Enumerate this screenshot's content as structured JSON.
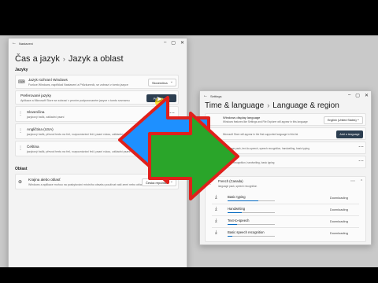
{
  "left_window": {
    "title": "Nastavení",
    "breadcrumb_parent": "Čas a jazyk",
    "breadcrumb_sep": "›",
    "breadcrumb_current": "Jazyk a oblast",
    "section_languages": "Jazyky",
    "display_language": {
      "title": "Jazyk rozhraní Windows",
      "subtitle": "Funkce Windows, například Nastavení a Průzkumník, se zobrazí v tomto jazyce",
      "value": "Slovenčina"
    },
    "preferred": {
      "title": "Preferované jazyky",
      "subtitle": "Aplikace a Microsoft Store se zobrazí v prvním podporovaném jazyce v tomto seznamu",
      "button": "Přidat jazyk"
    },
    "languages": [
      {
        "name": "Slovenčina",
        "detail": "jazykový balík, základní psaní"
      },
      {
        "name": "Angličtina (USA)",
        "detail": "jazykový balík, převod textu na řeč, rozpoznávání řeči, psaní rukou, základní psaní"
      },
      {
        "name": "Čeština",
        "detail": "jazykový balík, převod textu na řeč, rozpoznávání řeči, psaní rukou, základní psaní"
      }
    ],
    "section_region": "Oblast",
    "region": {
      "title": "Krajina alebo oblasť",
      "subtitle": "Windows a aplikace mohou na poskytování místního obsahu používat vaši zemi nebo oblast",
      "value": "Česká republika"
    }
  },
  "right_window": {
    "title": "Settings",
    "breadcrumb_parent": "Time & language",
    "breadcrumb_sep": "›",
    "breadcrumb_current": "Language & region",
    "display_language": {
      "title": "Windows display language",
      "subtitle": "Windows features like Settings and File Explorer will appear in this language",
      "value": "English (United States)"
    },
    "preferred": {
      "subtitle": "Microsoft Store will appear in the first supported language in this list",
      "button": "Add a language"
    },
    "language_row1": {
      "detail": "language pack, text-to-speech, speech recognition, handwriting, basic typing"
    },
    "language_row2": {
      "detail": "speech recognition, handwriting, basic typing"
    },
    "french": {
      "name": "French (Canada)",
      "detail": "language pack, speech recognition"
    },
    "downloads": [
      {
        "name": "Basic typing",
        "status": "Downloading",
        "progress": 0.65
      },
      {
        "name": "Handwriting",
        "status": "Downloading",
        "progress": 0.3
      },
      {
        "name": "Text-to-speech",
        "status": "Downloading",
        "progress": 0.2
      },
      {
        "name": "Basic speech recognition",
        "status": "Downloading",
        "progress": 0.1
      }
    ]
  },
  "arrows": {
    "left_color": "#1e90ff",
    "right_color": "#2aa52a",
    "outline": "#e0201b"
  }
}
